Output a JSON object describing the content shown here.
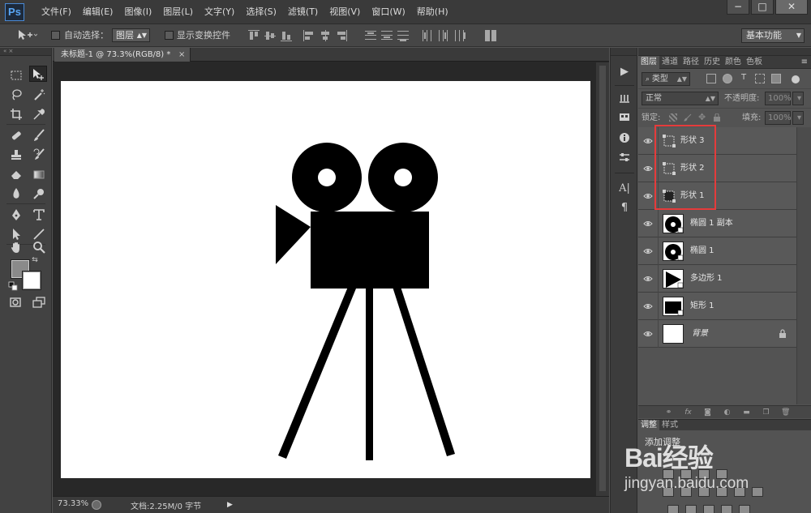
{
  "app": {
    "logo": "Ps",
    "menu": [
      "文件(F)",
      "编辑(E)",
      "图像(I)",
      "图层(L)",
      "文字(Y)",
      "选择(S)",
      "滤镜(T)",
      "视图(V)",
      "窗口(W)",
      "帮助(H)"
    ],
    "window_controls": [
      "−",
      "□",
      "✕"
    ]
  },
  "options_bar": {
    "auto_select_label": "自动选择：",
    "auto_select_target": "图层",
    "show_transform_label": "显示变换控件",
    "workspace": "基本功能"
  },
  "document": {
    "tab_title": "未标题-1 @ 73.3%(RGB/8) *",
    "tab_close": "×",
    "zoom": "73.33%",
    "doc_info": "文档:2.25M/0 字节"
  },
  "panel": {
    "tabs": [
      "图层",
      "通道",
      "路径",
      "历史",
      "颜色",
      "色板"
    ],
    "menu_icon": "≡",
    "filter_type": "类型",
    "blend_mode": "正常",
    "opacity_label": "不透明度:",
    "opacity_value": "100%",
    "lock_label": "锁定:",
    "fill_label": "填充:",
    "fill_value": "100%",
    "layers": [
      {
        "name": "形状 3",
        "kind": "shape"
      },
      {
        "name": "形状 2",
        "kind": "shape"
      },
      {
        "name": "形状 1",
        "kind": "shape"
      },
      {
        "name": "椭圆 1 副本",
        "kind": "ellipse"
      },
      {
        "name": "椭圆 1",
        "kind": "ellipse"
      },
      {
        "name": "多边形 1",
        "kind": "polygon"
      },
      {
        "name": "矩形 1",
        "kind": "rect"
      },
      {
        "name": "背景",
        "kind": "background"
      }
    ],
    "adjust_tabs": [
      "调整",
      "样式"
    ],
    "adjust_title": "添加调整"
  },
  "watermark": {
    "logo": "Bai经验",
    "url": "jingyan.baidu.com"
  },
  "colors": {
    "highlight": "#e53b3b",
    "fg": "#8a8a8a",
    "bg": "#ffffff"
  }
}
